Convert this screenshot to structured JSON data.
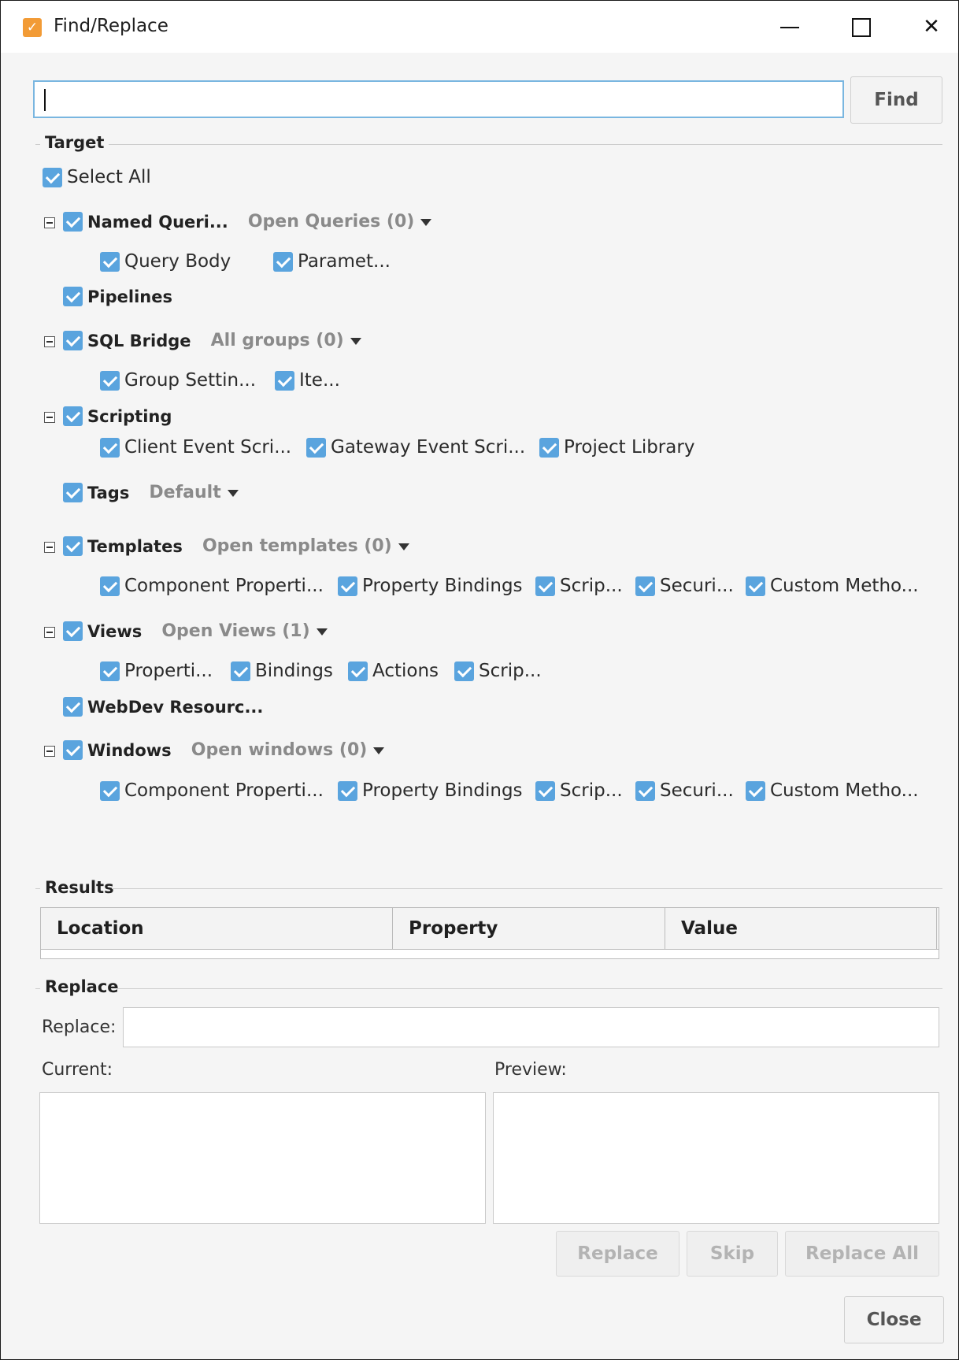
{
  "window": {
    "title": "Find/Replace",
    "app_icon_glyph": "✓",
    "accent_color": "#5aa4de",
    "icon_color": "#f29b36"
  },
  "search": {
    "value": "",
    "find_label": "Find"
  },
  "target": {
    "title": "Target",
    "select_all": "Select All",
    "named_queries": {
      "label": "Named Queri...",
      "dropdown": "Open Queries (0)",
      "children": [
        "Query Body",
        "Paramet..."
      ]
    },
    "pipelines": {
      "label": "Pipelines"
    },
    "sql_bridge": {
      "label": "SQL Bridge",
      "dropdown": "All groups (0)",
      "children": [
        "Group Settin...",
        "Ite..."
      ]
    },
    "scripting": {
      "label": "Scripting",
      "children": [
        "Client Event Scri...",
        "Gateway Event Scri...",
        "Project Library"
      ]
    },
    "tags": {
      "label": "Tags",
      "dropdown": "Default"
    },
    "templates": {
      "label": "Templates",
      "dropdown": "Open templates (0)",
      "children": [
        "Component Properti...",
        "Property Bindings",
        "Scrip...",
        "Securi...",
        "Custom Metho..."
      ]
    },
    "views": {
      "label": "Views",
      "dropdown": "Open Views (1)",
      "children": [
        "Properti...",
        "Bindings",
        "Actions",
        "Scrip..."
      ]
    },
    "webdev": {
      "label": "WebDev Resourc..."
    },
    "windows": {
      "label": "Windows",
      "dropdown": "Open windows (0)",
      "children": [
        "Component Properti...",
        "Property Bindings",
        "Scrip...",
        "Securi...",
        "Custom Metho..."
      ]
    }
  },
  "results": {
    "title": "Results",
    "columns": [
      "Location",
      "Property",
      "Value"
    ]
  },
  "replace": {
    "title": "Replace",
    "replace_label": "Replace:",
    "replace_value": "",
    "current_label": "Current:",
    "preview_label": "Preview:",
    "buttons": {
      "replace": "Replace",
      "skip": "Skip",
      "replace_all": "Replace All"
    }
  },
  "close_label": "Close"
}
